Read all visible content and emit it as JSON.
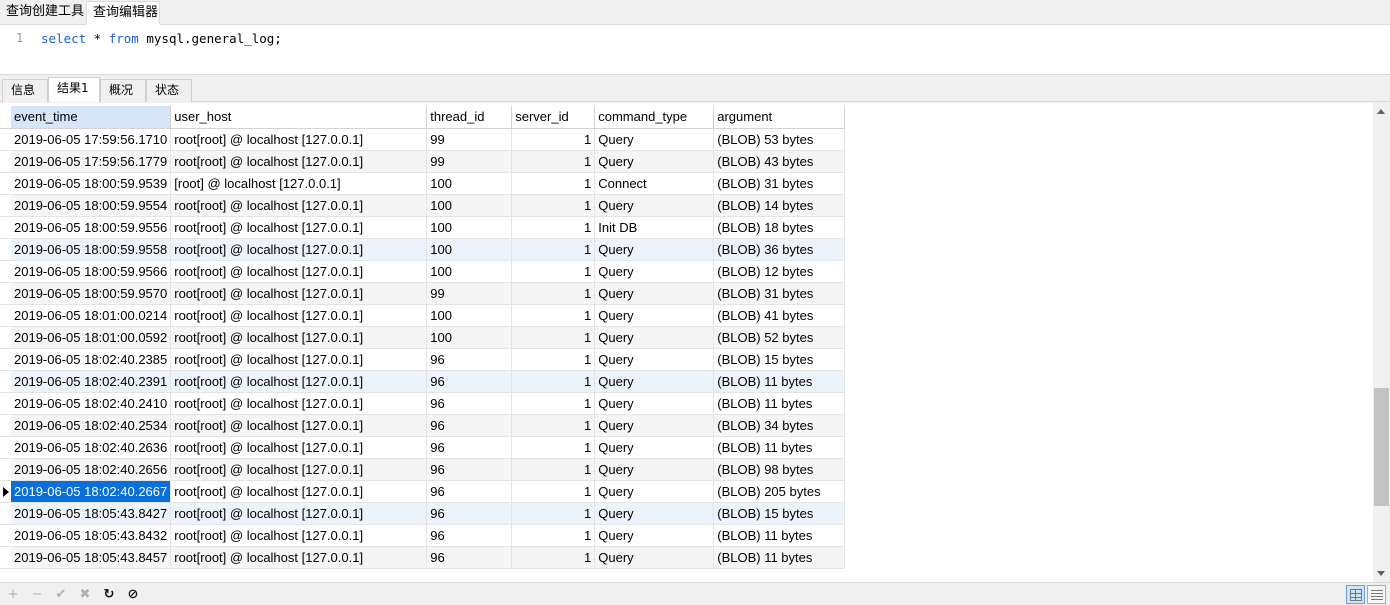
{
  "top_tabs": [
    "查询创建工具",
    "查询编辑器"
  ],
  "editor": {
    "line_number": "1",
    "code_tokens": [
      {
        "text": "select",
        "kw": true
      },
      {
        "text": " * ",
        "kw": false
      },
      {
        "text": "from",
        "kw": true
      },
      {
        "text": " mysql.general_log;",
        "kw": false
      }
    ]
  },
  "result_tabs": [
    "信息",
    "结果1",
    "概况",
    "状态"
  ],
  "grid": {
    "columns": [
      "event_time",
      "user_host",
      "thread_id",
      "server_id",
      "command_type",
      "argument"
    ],
    "rows": [
      [
        "2019-06-05 17:59:56.1710",
        "root[root] @ localhost [127.0.0.1]",
        "99",
        "1",
        "Query",
        "(BLOB) 53 bytes"
      ],
      [
        "2019-06-05 17:59:56.1779",
        "root[root] @ localhost [127.0.0.1]",
        "99",
        "1",
        "Query",
        "(BLOB) 43 bytes"
      ],
      [
        "2019-06-05 18:00:59.9539",
        "[root] @ localhost [127.0.0.1]",
        "100",
        "1",
        "Connect",
        "(BLOB) 31 bytes"
      ],
      [
        "2019-06-05 18:00:59.9554",
        "root[root] @ localhost [127.0.0.1]",
        "100",
        "1",
        "Query",
        "(BLOB) 14 bytes"
      ],
      [
        "2019-06-05 18:00:59.9556",
        "root[root] @ localhost [127.0.0.1]",
        "100",
        "1",
        "Init DB",
        "(BLOB) 18 bytes"
      ],
      [
        "2019-06-05 18:00:59.9558",
        "root[root] @ localhost [127.0.0.1]",
        "100",
        "1",
        "Query",
        "(BLOB) 36 bytes"
      ],
      [
        "2019-06-05 18:00:59.9566",
        "root[root] @ localhost [127.0.0.1]",
        "100",
        "1",
        "Query",
        "(BLOB) 12 bytes"
      ],
      [
        "2019-06-05 18:00:59.9570",
        "root[root] @ localhost [127.0.0.1]",
        "99",
        "1",
        "Query",
        "(BLOB) 31 bytes"
      ],
      [
        "2019-06-05 18:01:00.0214",
        "root[root] @ localhost [127.0.0.1]",
        "100",
        "1",
        "Query",
        "(BLOB) 41 bytes"
      ],
      [
        "2019-06-05 18:01:00.0592",
        "root[root] @ localhost [127.0.0.1]",
        "100",
        "1",
        "Query",
        "(BLOB) 52 bytes"
      ],
      [
        "2019-06-05 18:02:40.2385",
        "root[root] @ localhost [127.0.0.1]",
        "96",
        "1",
        "Query",
        "(BLOB) 15 bytes"
      ],
      [
        "2019-06-05 18:02:40.2391",
        "root[root] @ localhost [127.0.0.1]",
        "96",
        "1",
        "Query",
        "(BLOB) 11 bytes"
      ],
      [
        "2019-06-05 18:02:40.2410",
        "root[root] @ localhost [127.0.0.1]",
        "96",
        "1",
        "Query",
        "(BLOB) 11 bytes"
      ],
      [
        "2019-06-05 18:02:40.2534",
        "root[root] @ localhost [127.0.0.1]",
        "96",
        "1",
        "Query",
        "(BLOB) 34 bytes"
      ],
      [
        "2019-06-05 18:02:40.2636",
        "root[root] @ localhost [127.0.0.1]",
        "96",
        "1",
        "Query",
        "(BLOB) 11 bytes"
      ],
      [
        "2019-06-05 18:02:40.2656",
        "root[root] @ localhost [127.0.0.1]",
        "96",
        "1",
        "Query",
        "(BLOB) 98 bytes"
      ],
      [
        "2019-06-05 18:02:40.2667",
        "root[root] @ localhost [127.0.0.1]",
        "96",
        "1",
        "Query",
        "(BLOB) 205 bytes"
      ],
      [
        "2019-06-05 18:05:43.8427",
        "root[root] @ localhost [127.0.0.1]",
        "96",
        "1",
        "Query",
        "(BLOB) 15 bytes"
      ],
      [
        "2019-06-05 18:05:43.8432",
        "root[root] @ localhost [127.0.0.1]",
        "96",
        "1",
        "Query",
        "(BLOB) 11 bytes"
      ],
      [
        "2019-06-05 18:05:43.8457",
        "root[root] @ localhost [127.0.0.1]",
        "96",
        "1",
        "Query",
        "(BLOB) 11 bytes"
      ]
    ],
    "selected_row_index": 16,
    "highlighted_row_indices": [
      5,
      11,
      17
    ]
  },
  "toolbar": {
    "buttons": [
      {
        "icon": "plus-icon",
        "glyph": "+",
        "enabled": false
      },
      {
        "icon": "minus-icon",
        "glyph": "−",
        "enabled": false
      },
      {
        "icon": "check-icon",
        "glyph": "✔",
        "enabled": false
      },
      {
        "icon": "cross-icon",
        "glyph": "✖",
        "enabled": false
      },
      {
        "icon": "refresh-icon",
        "glyph": "↻",
        "enabled": true
      },
      {
        "icon": "stop-icon",
        "glyph": "⊘",
        "enabled": true
      }
    ],
    "views": [
      {
        "icon": "grid-view-icon",
        "active": true
      },
      {
        "icon": "form-view-icon",
        "active": false
      }
    ]
  },
  "colors": {
    "keyword": "#1a5fd3",
    "selection": "#0a6fd8",
    "sorted_header": "#d6e5f7"
  }
}
